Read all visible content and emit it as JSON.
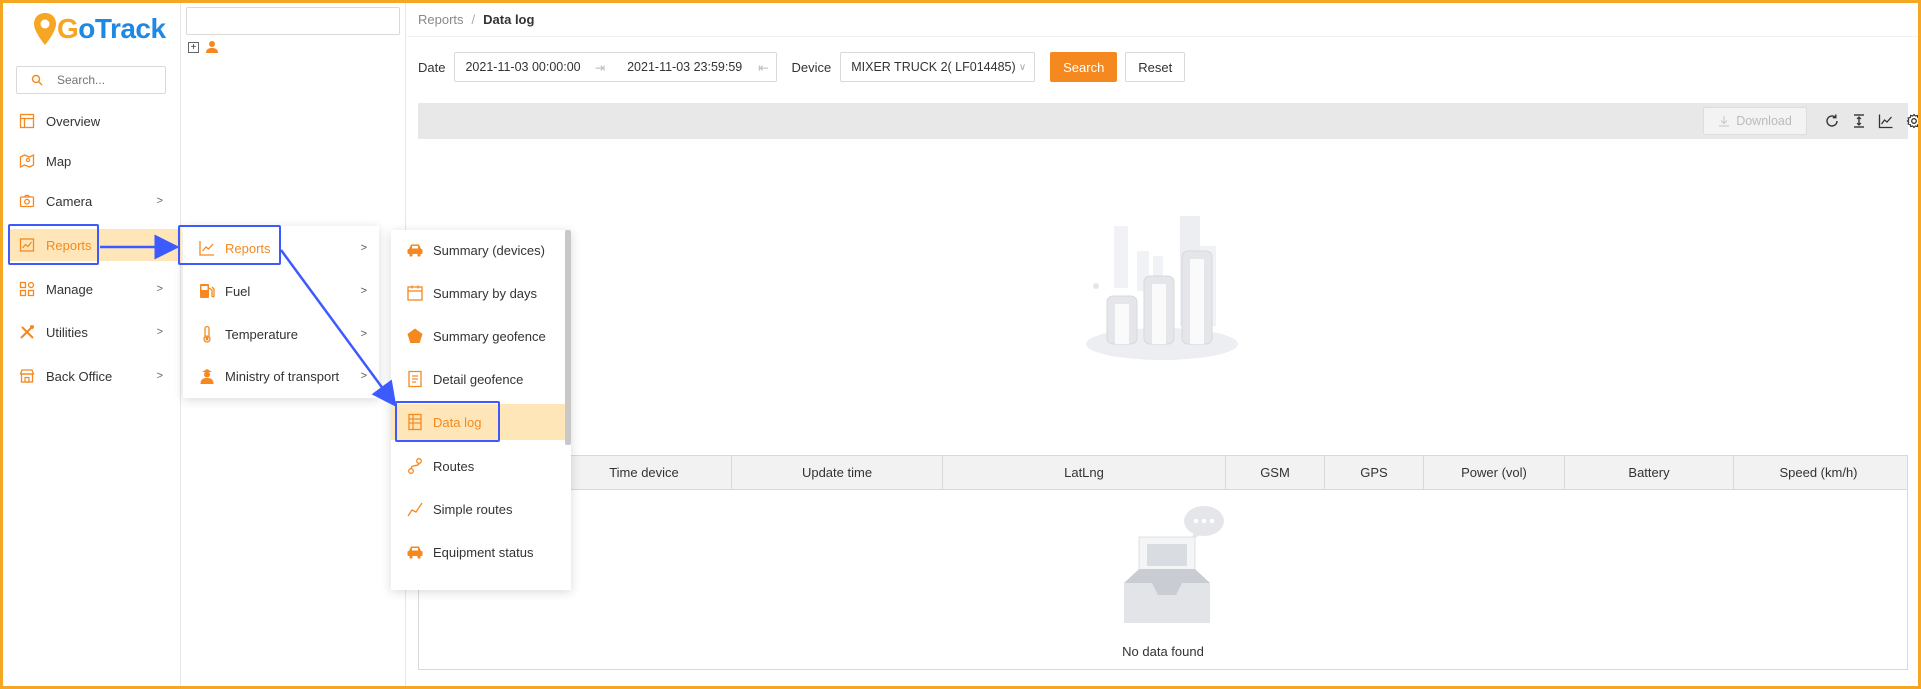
{
  "app": {
    "logo_text_g": "G",
    "logo_text_rest": "oTrack"
  },
  "sidebar": {
    "search_placeholder": "Search...",
    "items": [
      {
        "label": "Overview",
        "icon": "overview-icon"
      },
      {
        "label": "Map",
        "icon": "map-icon"
      },
      {
        "label": "Camera",
        "icon": "camera-icon",
        "chevron": ">"
      },
      {
        "label": "Reports",
        "icon": "reports-icon"
      },
      {
        "label": "Manage",
        "icon": "manage-icon",
        "chevron": ">"
      },
      {
        "label": "Utilities",
        "icon": "utilities-icon",
        "chevron": ">"
      },
      {
        "label": "Back Office",
        "icon": "back-office-icon",
        "chevron": ">"
      }
    ]
  },
  "breadcrumb": {
    "parent": "Reports",
    "sep": "/",
    "current": "Data log"
  },
  "filters": {
    "date_label": "Date",
    "date_from": "2021-11-03 00:00:00",
    "date_to": "2021-11-03 23:59:59",
    "device_label": "Device",
    "device_value": "MIXER TRUCK 2( LF014485)",
    "search_button": "Search",
    "reset_button": "Reset"
  },
  "toolbar": {
    "download_label": "Download"
  },
  "table": {
    "columns": [
      "Time device",
      "Update time",
      "LatLng",
      "GSM",
      "GPS",
      "Power (vol)",
      "Battery",
      "Speed (km/h)"
    ],
    "empty_text": "No data found"
  },
  "menu1": {
    "items": [
      {
        "label": "Reports",
        "chevron": ">"
      },
      {
        "label": "Fuel",
        "chevron": ">"
      },
      {
        "label": "Temperature",
        "chevron": ">"
      },
      {
        "label": "Ministry of transport",
        "chevron": ">"
      }
    ]
  },
  "menu2": {
    "items": [
      {
        "label": "Summary (devices)"
      },
      {
        "label": "Summary by days"
      },
      {
        "label": "Summary geofence"
      },
      {
        "label": "Detail geofence"
      },
      {
        "label": "Data log"
      },
      {
        "label": "Routes"
      },
      {
        "label": "Simple routes"
      },
      {
        "label": "Equipment status"
      }
    ]
  },
  "colors": {
    "accent": "#f5891f",
    "active_bg": "#ffe6b8",
    "highlight": "#3d5afe",
    "frame": "#f5a623",
    "brand_blue": "#1e88e5"
  }
}
